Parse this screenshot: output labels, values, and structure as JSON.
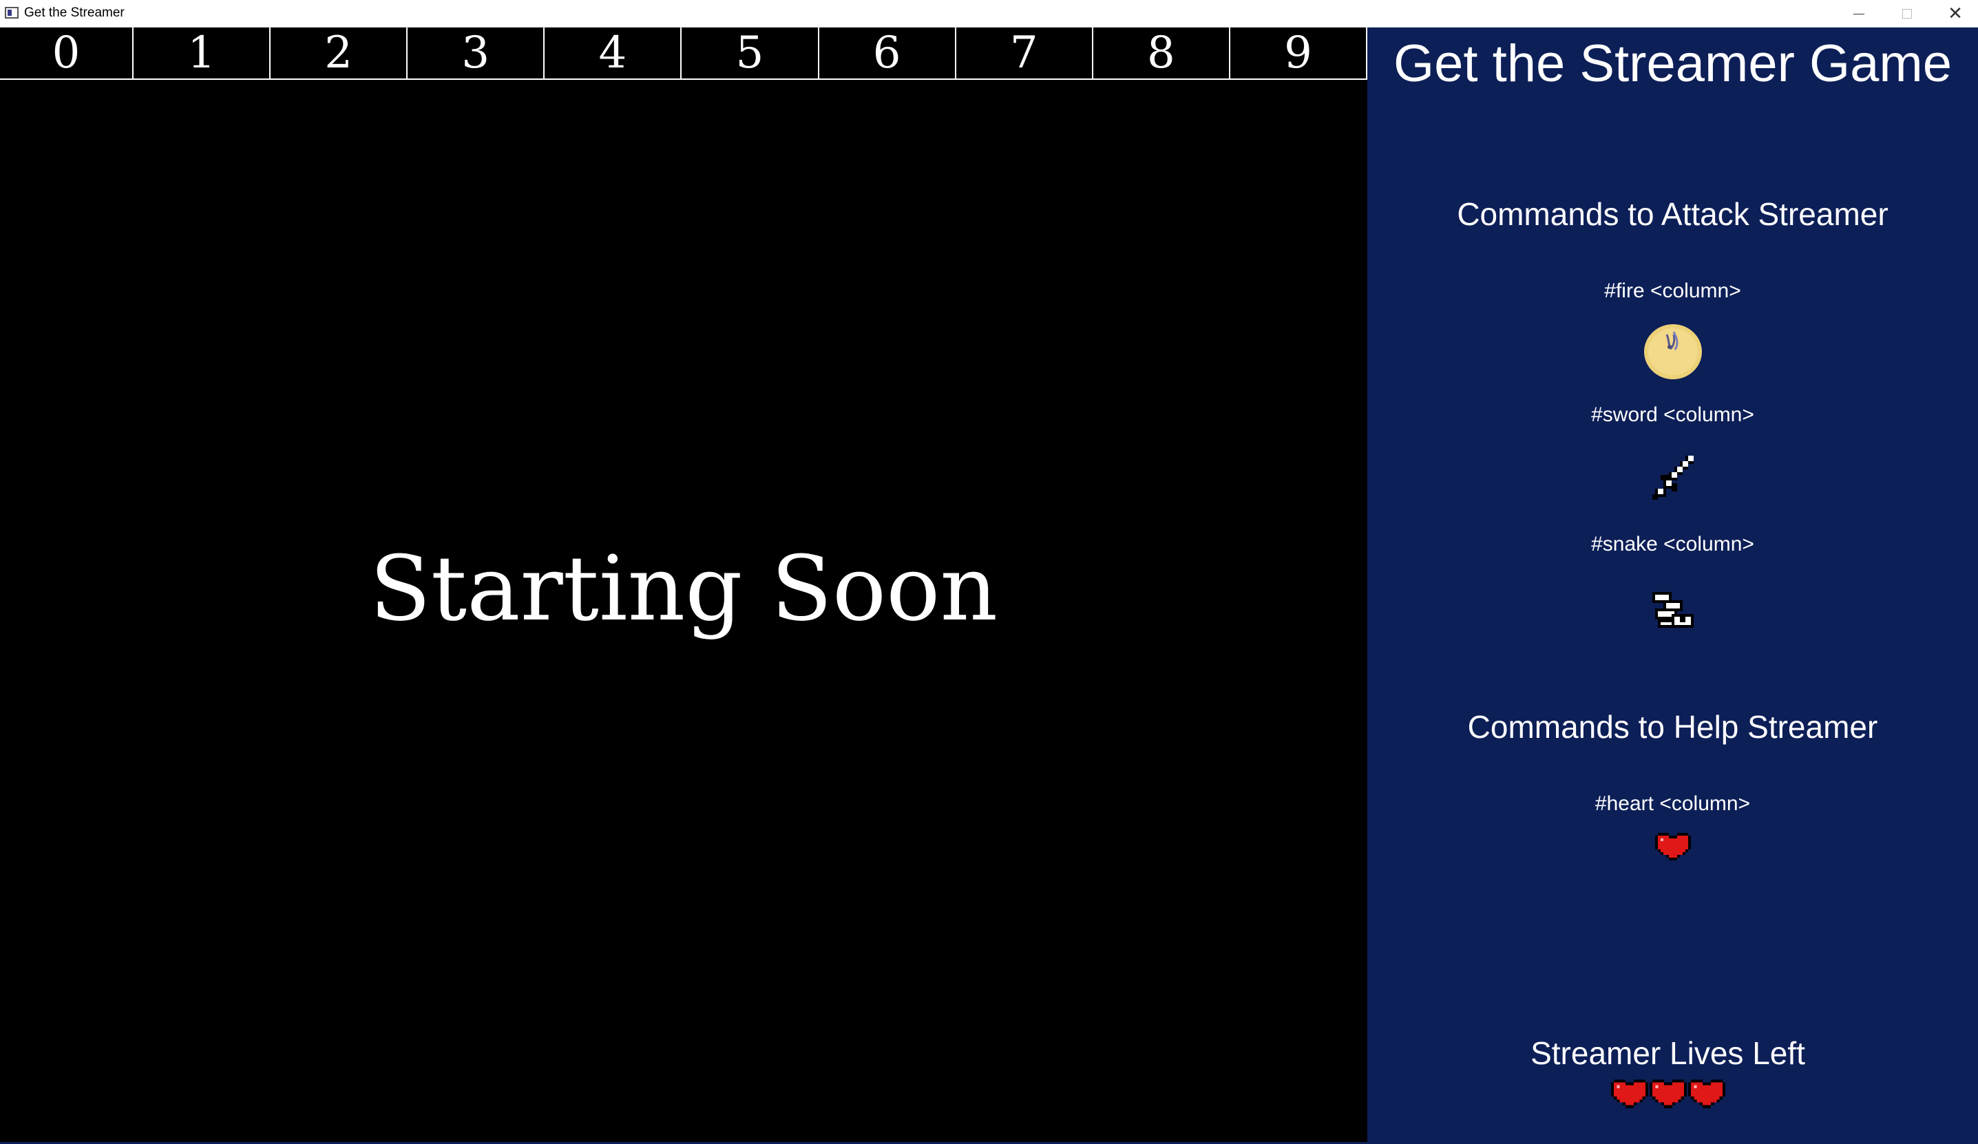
{
  "window": {
    "title": "Get the Streamer",
    "minimize_icon": "minimize-icon",
    "maximize_icon": "maximize-icon",
    "close_icon": "close-icon",
    "close_glyph": "✕"
  },
  "game": {
    "columns": [
      "0",
      "1",
      "2",
      "3",
      "4",
      "5",
      "6",
      "7",
      "8",
      "9"
    ],
    "status_text": "Starting Soon",
    "background": "#000000"
  },
  "panel": {
    "title": "Get the Streamer Game",
    "background": "#0d1f57",
    "attack": {
      "heading": "Commands to Attack Streamer",
      "commands": [
        {
          "label": "#fire <column>",
          "icon": "fireball-icon"
        },
        {
          "label": "#sword <column>",
          "icon": "sword-icon"
        },
        {
          "label": "#snake <column>",
          "icon": "snake-icon"
        }
      ]
    },
    "help": {
      "heading": "Commands to Help Streamer",
      "commands": [
        {
          "label": "#heart <column>",
          "icon": "heart-icon"
        }
      ]
    },
    "lives": {
      "heading": "Streamer Lives Left",
      "count": 3,
      "icon": "heart-icon",
      "color": "#e01818"
    }
  }
}
